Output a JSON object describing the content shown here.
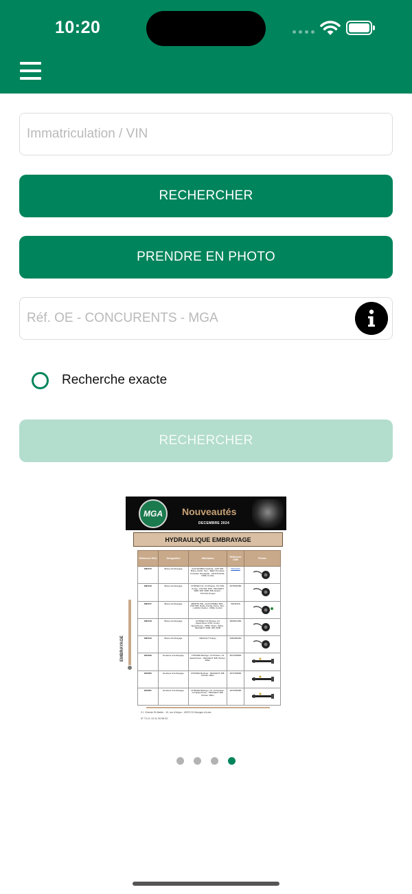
{
  "status_bar": {
    "time": "10:20"
  },
  "form": {
    "vin_placeholder": "Immatriculation / VIN",
    "search_button": "RECHERCHER",
    "photo_button": "PRENDRE EN PHOTO",
    "ref_placeholder": "Réf. OE - CONCURENTS - MGA",
    "exact_label": "Recherche exacte",
    "search_button_2": "RECHERCHER"
  },
  "flyer": {
    "logo": "MGA",
    "title": "Nouveautés",
    "date": "DECEMBRE 2024",
    "banner": "HYDRAULIQUE EMBRAYAGE",
    "side_label": "EMBRAYAGE",
    "columns": [
      "Référence MGA",
      "Designation",
      "Affectation",
      "Référence OEM",
      "Photos"
    ],
    "rows": [
      {
        "ref": "EB5115",
        "designation": "Butée d'embrayage",
        "application": "ALFA ROMEO Giulietta - FIAT 500, Bravo, Doblo, Tipo - JEEP Cherokee, Compass, Renegade - LANCIA Delta - OPEL Combo",
        "oem": "55224915"
      },
      {
        "ref": "EB5116",
        "designation": "Butée d'embrayage",
        "application": "CITROEN C4, C4 Picasso, C5, DS5, Jumpy - DS DS4, DS5 - PEUGEOT 3008, 308, 5008, 508, Expert - TOYOTA Proace",
        "oem": "9675000480"
      },
      {
        "ref": "EB5117",
        "designation": "Butée d'embrayage",
        "application": "ABARTH 500 - ALFA ROMEO MiTo - FIAT 500, Doblo, Panda, Punto, Tipo - LANCIA Ypsilon - OPEL Combo",
        "oem": "55241819"
      },
      {
        "ref": "EB5118",
        "designation": "Butée d'embrayage",
        "application": "CITROEN C4 Picasso, C4 SpaceTourer, DS4, Jumpy, SpaceTourer - OPEL Vivaro, Zafira - PEUGEOT 3008, 308, 5008",
        "oem": "9818510480"
      },
      {
        "ref": "EB5119",
        "designation": "Butée d'embrayage",
        "application": "RENAULT Twingo",
        "oem": "306206504R"
      },
      {
        "ref": "EE5249",
        "designation": "Emetteur d'embrayage",
        "application": "CITROEN Berlingo, C4 Picasso, C4 SpaceTourer - PEUGEOT 308, Partner, Rifter",
        "oem": "9674259580"
      },
      {
        "ref": "EE5250",
        "designation": "Emetteur d'embrayage",
        "application": "CITROEN Berlingo - PEUGEOT 308, Partner, Rifter",
        "oem": "9674259680"
      },
      {
        "ref": "EE5251",
        "designation": "Emetteur d'embrayage",
        "application": "CITROEN Berlingo, C3, C4 Picasso, C4 SpaceTourer - PEUGEOT 308, Partner, Rifter",
        "oem": "9674259380"
      }
    ],
    "footer_address": "Z.I. Chemin St Martin - 10, rue d'Anjou - 49370 St Georges s/Loire",
    "footer_phone": "N° T.S.G. 02 41 39 58 93"
  },
  "carousel": {
    "count": 4,
    "active_index": 3
  },
  "colors": {
    "brand_green": "#00845b",
    "disabled_green": "#b3ddcd",
    "flyer_tan": "#c8a98a"
  }
}
